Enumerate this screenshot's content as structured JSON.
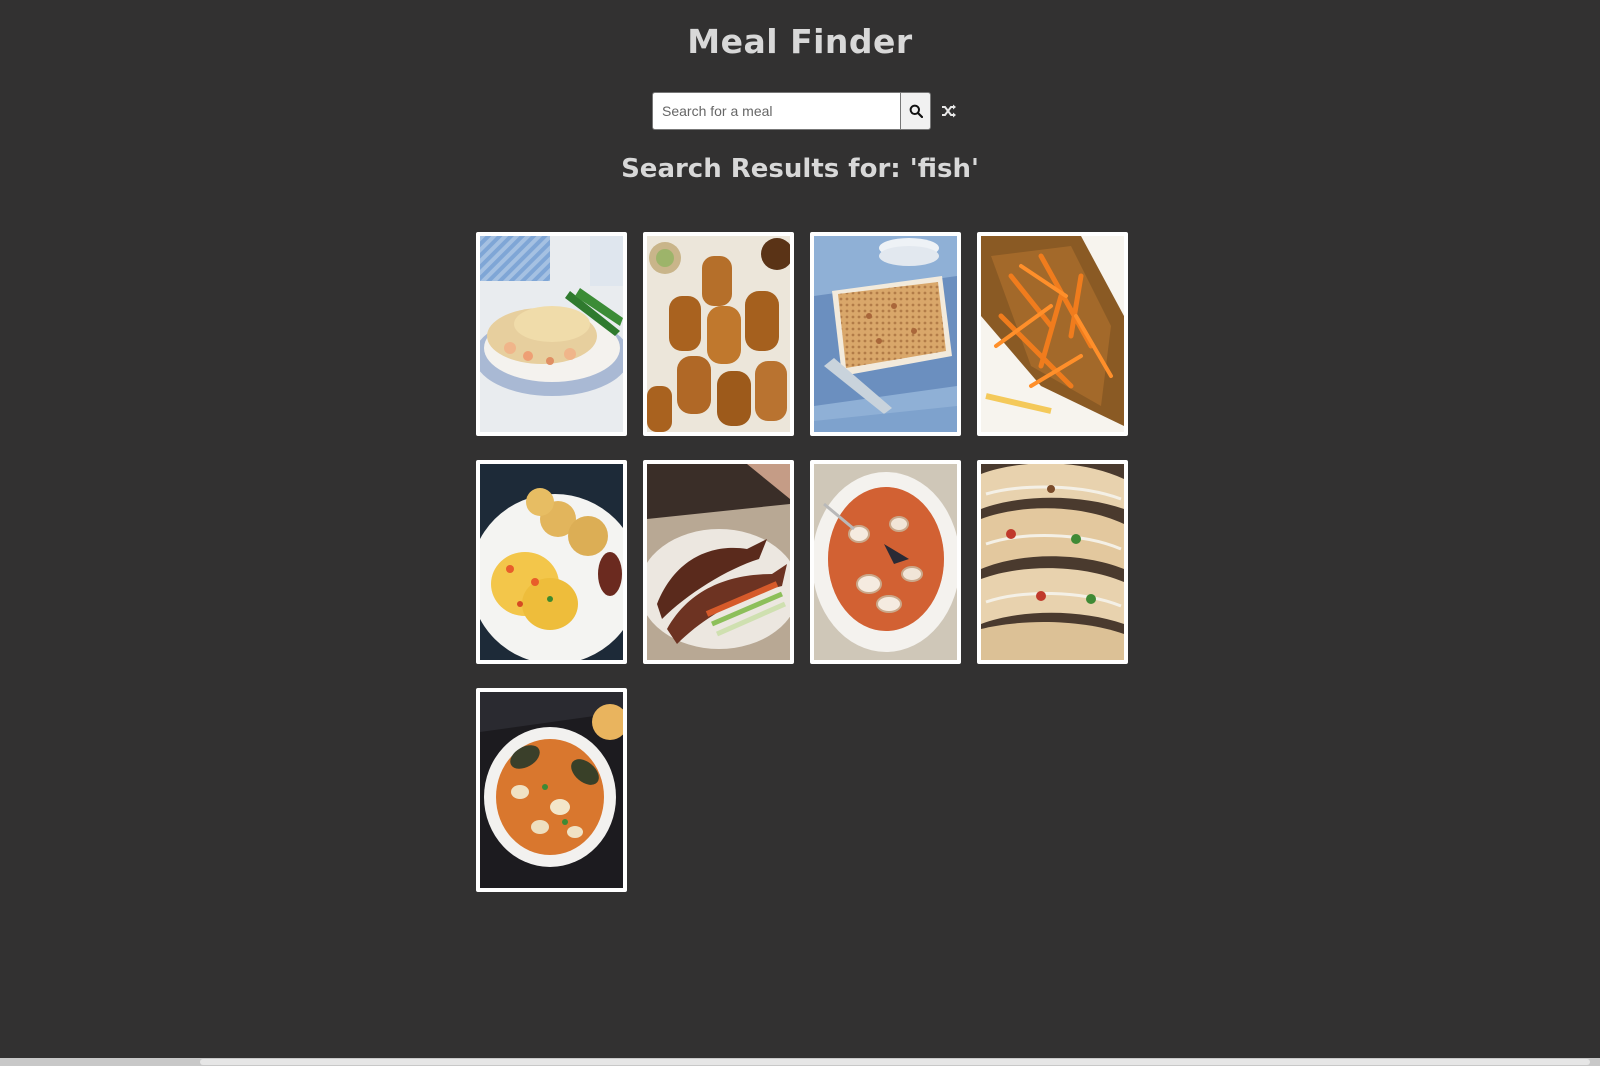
{
  "header": {
    "title": "Meal Finder"
  },
  "search": {
    "placeholder": "Search for a meal",
    "value": "",
    "search_icon": "search-icon",
    "random_icon": "shuffle-icon"
  },
  "results": {
    "heading": "Search Results for: 'fish'",
    "meals": [
      {
        "icon": "fish-pie-image"
      },
      {
        "icon": "croquettes-image"
      },
      {
        "icon": "gratin-bake-image"
      },
      {
        "icon": "fried-fish-carrots-image"
      },
      {
        "icon": "ackee-saltfish-image"
      },
      {
        "icon": "grilled-fish-image"
      },
      {
        "icon": "seafood-soup-image"
      },
      {
        "icon": "fish-tacos-image"
      },
      {
        "icon": "mussel-stew-image"
      }
    ]
  }
}
